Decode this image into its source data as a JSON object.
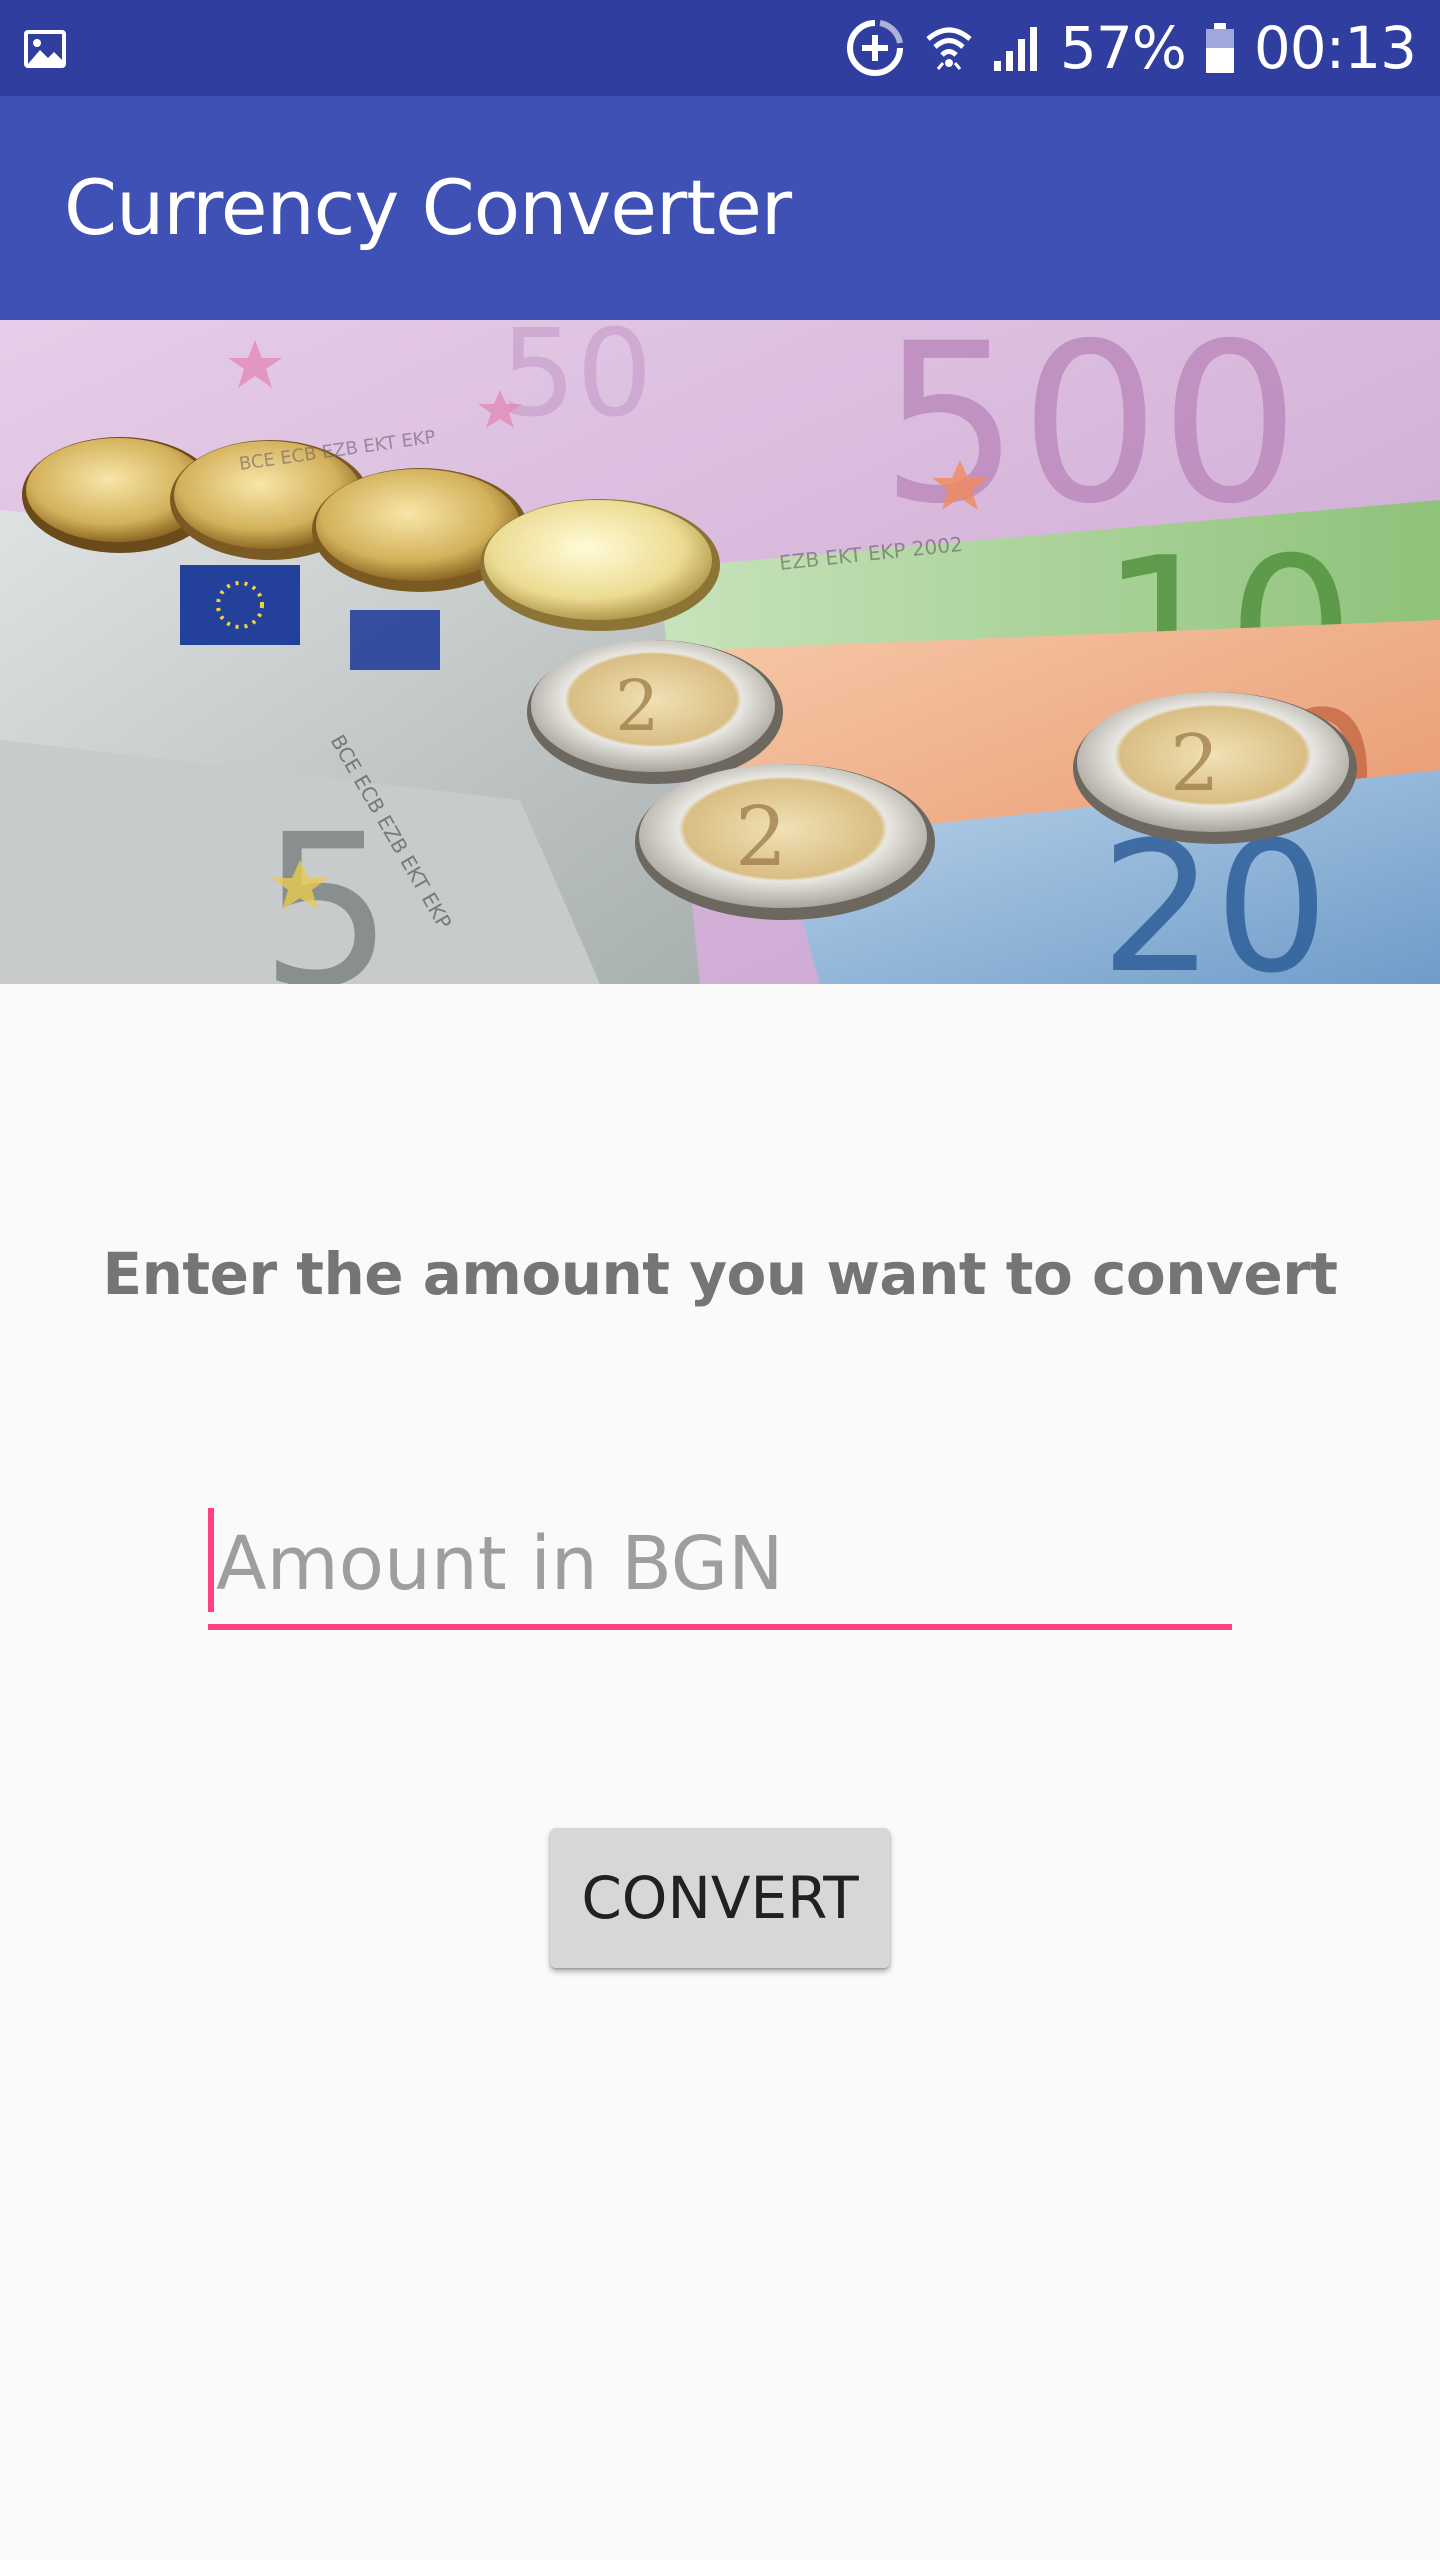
{
  "status_bar": {
    "left_icon": "image-icon",
    "icons": [
      "data-saver-icon",
      "wifi-icon",
      "signal-icon",
      "battery-icon"
    ],
    "battery_percent": "57%",
    "time": "00:13",
    "background": "#303f9f"
  },
  "app_bar": {
    "title": "Currency Converter",
    "background": "#3f51b5"
  },
  "hero": {
    "description_icon": "euro-banknotes-and-coins-image"
  },
  "main": {
    "prompt": "Enter the amount you want to convert",
    "amount_input": {
      "value": "",
      "placeholder": "Amount in BGN",
      "accent": "#ff4081"
    },
    "convert_label": "CONVERT"
  }
}
